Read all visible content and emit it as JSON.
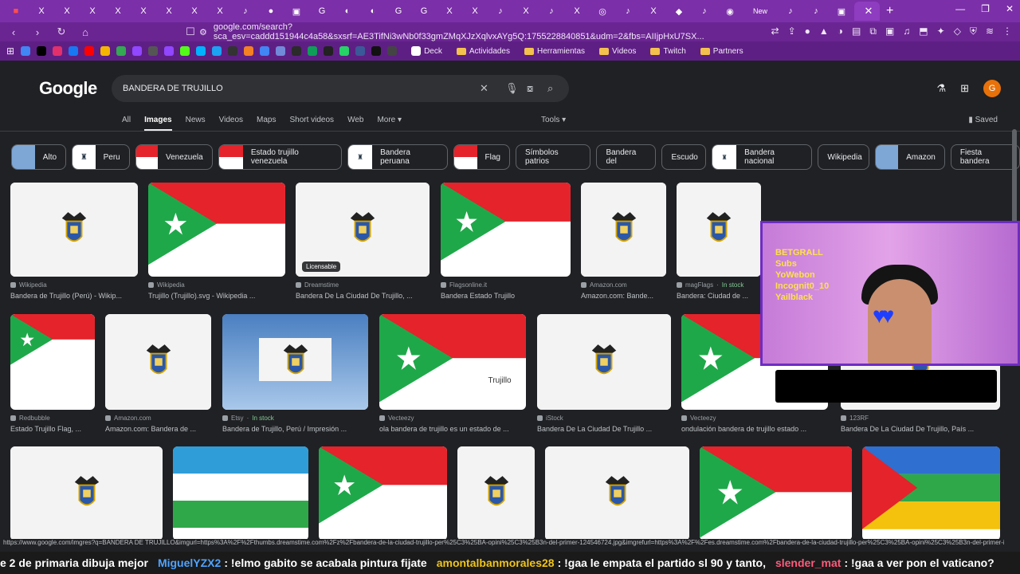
{
  "browser": {
    "new_tab_label": "New",
    "url": "google.com/search?sca_esv=caddd151944c4a58&sxsrf=AE3TifNi3wNb0f33gmZMqXJzXqlvxAYg5Q:1755228840851&udm=2&fbs=AIIjpHxU7SX...",
    "bookmarks": [
      "Deck",
      "Actividades",
      "Herramientas",
      "Videos",
      "Twitch",
      "Partners"
    ]
  },
  "google": {
    "logo": "Google",
    "query": "BANDERA DE TRUJILLO",
    "filters": [
      "All",
      "Images",
      "News",
      "Videos",
      "Maps",
      "Short videos",
      "Web",
      "More"
    ],
    "active_filter": "Images",
    "tools": "Tools",
    "saved": "Saved",
    "avatar_letter": "G",
    "chips": [
      "Alto",
      "Peru",
      "Venezuela",
      "Estado trujillo venezuela",
      "Bandera peruana",
      "Flag",
      "Símbolos patrios",
      "Bandera del",
      "Escudo",
      "Bandera nacional",
      "Wikipedia",
      "Amazon",
      "Fiesta bandera"
    ]
  },
  "results": {
    "row1": [
      {
        "source": "Wikipedia",
        "title": "Bandera de Trujillo (Perú) - Wikip...",
        "kind": "white"
      },
      {
        "source": "Wikipedia",
        "title": "Trujillo (Trujillo).svg - Wikipedia ...",
        "kind": "trujillo"
      },
      {
        "source": "Dreamstime",
        "title": "Bandera De La Ciudad De Trujillo, ...",
        "kind": "white",
        "badge": "Licensable"
      },
      {
        "source": "Flagsonline.it",
        "title": "Bandera Estado Trujillo",
        "kind": "trujillo"
      },
      {
        "source": "Amazon.com",
        "title": "Amazon.com: Bande...",
        "kind": "white"
      },
      {
        "source": "magFlags",
        "stock": "In stock",
        "title": "Bandera: Ciudad de ...",
        "kind": "white"
      }
    ],
    "row2": [
      {
        "source": "Redbubble",
        "title": "Estado Trujillo Flag, ...",
        "kind": "trujillo"
      },
      {
        "source": "Amazon.com",
        "title": "Amazon.com: Bandera de ...",
        "kind": "white"
      },
      {
        "source": "Etsy",
        "stock": "In stock",
        "title": "Bandera de Trujillo, Perú / Impresión ...",
        "kind": "sky"
      },
      {
        "source": "Vecteezy",
        "title": "ola bandera de trujillo es un estado de ...",
        "kind": "trujillo",
        "caption": "Trujillo"
      },
      {
        "source": "iStock",
        "title": "Bandera De La Ciudad De Trujillo ...",
        "kind": "white"
      },
      {
        "source": "Vecteezy",
        "title": "ondulación bandera de trujillo estado ...",
        "kind": "trujillo"
      },
      {
        "source": "123RF",
        "title": "Bandera De La Ciudad De Trujillo, País ...",
        "kind": "white"
      }
    ],
    "row3": [
      {
        "kind": "white"
      },
      {
        "kind": "green"
      },
      {
        "kind": "trujillo"
      },
      {
        "kind": "white"
      },
      {
        "kind": "white"
      },
      {
        "kind": "trujillo"
      },
      {
        "kind": "tricolor"
      }
    ]
  },
  "status_url": "https://www.google.com/imgres?q=BANDERA DE TRUJILLO&imgurl=https%3A%2F%2Fthumbs.dreamstime.com%2Fz%2Fbandera-de-la-ciudad-trujillo-per%25C3%25BA-opini%25C3%25B3n-del-primer-124546724.jpg&imgrefurl=https%3A%2F%2Fes.dreamstime.com%2Fbandera-de-la-ciudad-trujillo-per%25C3%25BA-opini%25C3%25B3n-del-primer-i...",
  "stream": {
    "overlay_lines": [
      "BETGRALL",
      "Subs",
      "YoWebon",
      "Incognit0_10",
      "Yailblack"
    ],
    "chat": [
      {
        "user": "",
        "msg": "e 2 de primaria dibuja mejor"
      },
      {
        "user": "MiguelYZX2",
        "msg": ": !elmo gabito se acabala pintura fijate"
      },
      {
        "user": "amontalbanmorales28",
        "msg": ": !gaa le empata el partido sl 90 y tanto,"
      },
      {
        "user": "slender_mat",
        "msg": ": !gaa a ver pon el vaticano?"
      }
    ]
  },
  "colors": {
    "red": "#e4232b",
    "green": "#1fa84a",
    "tab": "#7b2fa8"
  }
}
